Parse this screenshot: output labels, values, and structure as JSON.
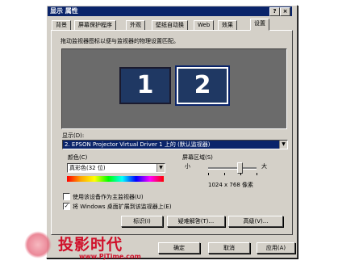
{
  "window": {
    "title": "显示 属性",
    "help_glyph": "?",
    "close_glyph": "×"
  },
  "tabs": [
    {
      "label": "背景"
    },
    {
      "label": "屏幕保护程序"
    },
    {
      "label": "外观"
    },
    {
      "label": "壁纸自动换"
    },
    {
      "label": "Web"
    },
    {
      "label": "效果"
    },
    {
      "label": "设置"
    }
  ],
  "settings": {
    "description": "拖动监视器图标以便与监视器的物理设置匹配。",
    "monitors": [
      {
        "number": "1",
        "selected": false
      },
      {
        "number": "2",
        "selected": true
      }
    ],
    "display_label": "显示(D):",
    "display_value": "2. EPSON Projector Virtual Driver 1 上的 (默认监视器)",
    "colors_label": "颜色(C)",
    "colors_value": "真彩色(32 位)",
    "screen_area_label": "屏幕区域(S)",
    "slider_less": "小",
    "slider_more": "大",
    "slider_level_fraction": 0.65,
    "resolution_text": "1024 x 768 像素",
    "primary_checkbox": {
      "label": "使用该设备作为主监视器(U)",
      "checked": false
    },
    "extend_checkbox": {
      "label": "将 Windows 桌面扩展到该监视器上(E)",
      "checked": true
    },
    "identify_button": "标识(I)",
    "troubleshoot_button": "疑难解答(T)...",
    "advanced_button": "高级(V)..."
  },
  "footer": {
    "ok_button": "确定",
    "cancel_button": "取消",
    "apply_button": "应用(A)"
  },
  "watermark": {
    "text": "投影时代",
    "url": "www.PjTime.com"
  },
  "colors": {
    "dialog_face": "#d4d0c8",
    "titlebar": "#0a246a",
    "monitor_bg": "#6b6b6b",
    "monitor_tile": "#1f3863",
    "watermark": "#d0102a"
  }
}
